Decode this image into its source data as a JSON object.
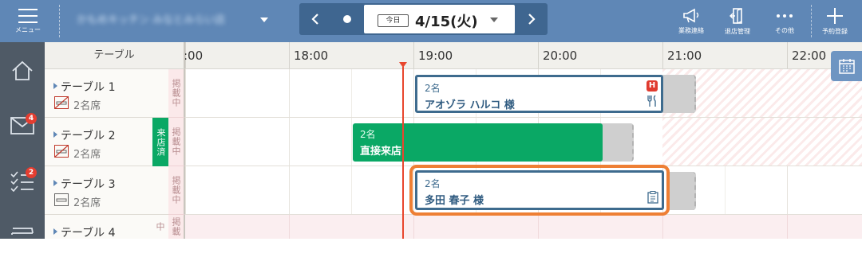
{
  "topbar": {
    "menu_label": "メニュー",
    "store_name": "かもめキッチン みなとみらい店",
    "date_nav": {
      "today_label": "今日",
      "date": "4/15(火)"
    },
    "actions": [
      {
        "label": "業務連絡",
        "icon": "megaphone-icon"
      },
      {
        "label": "退店管理",
        "icon": "door-exit-icon"
      },
      {
        "label": "その他",
        "icon": "more-dots-icon"
      },
      {
        "label": "予約登録",
        "icon": "plus-icon"
      }
    ]
  },
  "leftnav": {
    "items": [
      {
        "icon": "home-icon",
        "badge": ""
      },
      {
        "icon": "mail-icon",
        "badge": "4"
      },
      {
        "icon": "checklist-icon",
        "badge": "2"
      },
      {
        "icon": "store-icon",
        "badge": ""
      }
    ]
  },
  "timeline": {
    "table_header": "テーブル",
    "hours": [
      ":00",
      "18:00",
      "19:00",
      "20:00",
      "21:00",
      "22:00"
    ],
    "listing_label": "掲載中",
    "visited_label": "来店済"
  },
  "rows": [
    {
      "name": "テーブル 1",
      "seats": "2名席"
    },
    {
      "name": "テーブル 2",
      "seats": "2名席"
    },
    {
      "name": "テーブル 3",
      "seats": "2名席"
    },
    {
      "name": "テーブル 4",
      "seats": ""
    }
  ],
  "reservations": [
    {
      "party": "2名",
      "name": "アオゾラ ハルコ 様",
      "badge": "H"
    },
    {
      "party": "2名",
      "name": "直接来店"
    },
    {
      "party": "2名",
      "name": "多田 春子 様"
    }
  ],
  "colors": {
    "topbar": "#5f87b6",
    "leftnav": "#4f5a66",
    "walkin": "#0aa865",
    "reservation_border": "#3e6b8e",
    "selected_outline": "#ee7f34",
    "now_line": "#e8462d"
  }
}
